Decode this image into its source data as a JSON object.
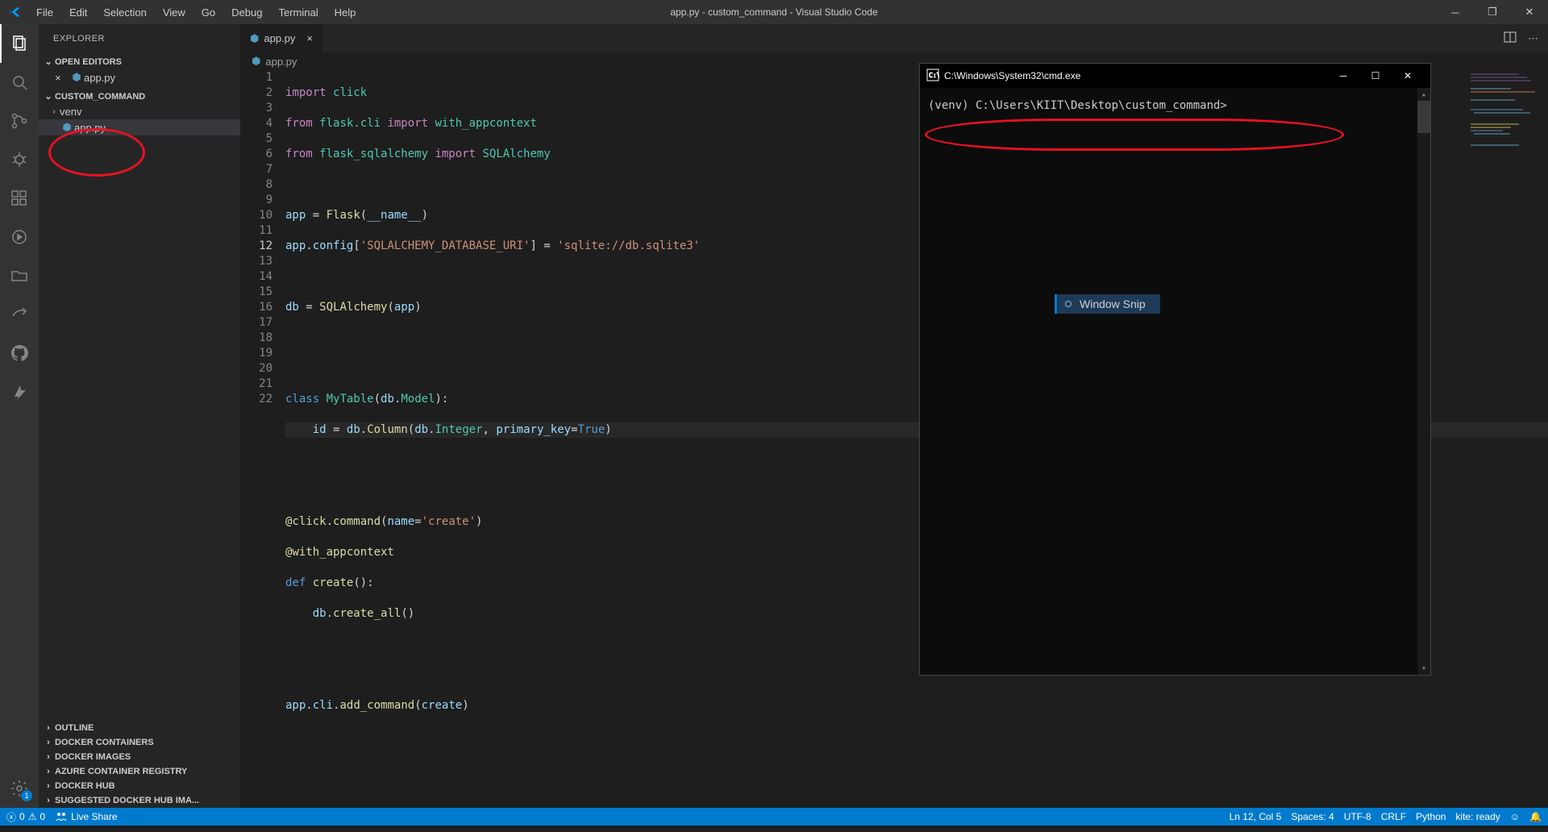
{
  "titlebar": {
    "menus": [
      "File",
      "Edit",
      "Selection",
      "View",
      "Go",
      "Debug",
      "Terminal",
      "Help"
    ],
    "title": "app.py - custom_command - Visual Studio Code"
  },
  "sidebar": {
    "header": "EXPLORER",
    "open_editors": {
      "title": "OPEN EDITORS",
      "items": [
        {
          "name": "app.py"
        }
      ]
    },
    "project": {
      "title": "CUSTOM_COMMAND",
      "items": [
        {
          "name": "venv",
          "type": "folder"
        },
        {
          "name": "app.py",
          "type": "file",
          "active": true
        }
      ]
    },
    "collapsed": [
      "OUTLINE",
      "DOCKER CONTAINERS",
      "DOCKER IMAGES",
      "AZURE CONTAINER REGISTRY",
      "DOCKER HUB",
      "SUGGESTED DOCKER HUB IMA..."
    ]
  },
  "tabs": {
    "active": "app.py",
    "breadcrumb": "app.py"
  },
  "code": {
    "lines": 22
  },
  "cmd": {
    "title": "C:\\Windows\\System32\\cmd.exe",
    "prompt": "(venv) C:\\Users\\KIIT\\Desktop\\custom_command>"
  },
  "snip": {
    "label": "Window Snip"
  },
  "status": {
    "errors": "0",
    "warnings": "0",
    "live": "Live Share",
    "ln": "Ln 12, Col 5",
    "spaces": "Spaces: 4",
    "enc": "UTF-8",
    "eol": "CRLF",
    "lang": "Python",
    "kite": "kite: ready"
  },
  "settings_badge": "1"
}
